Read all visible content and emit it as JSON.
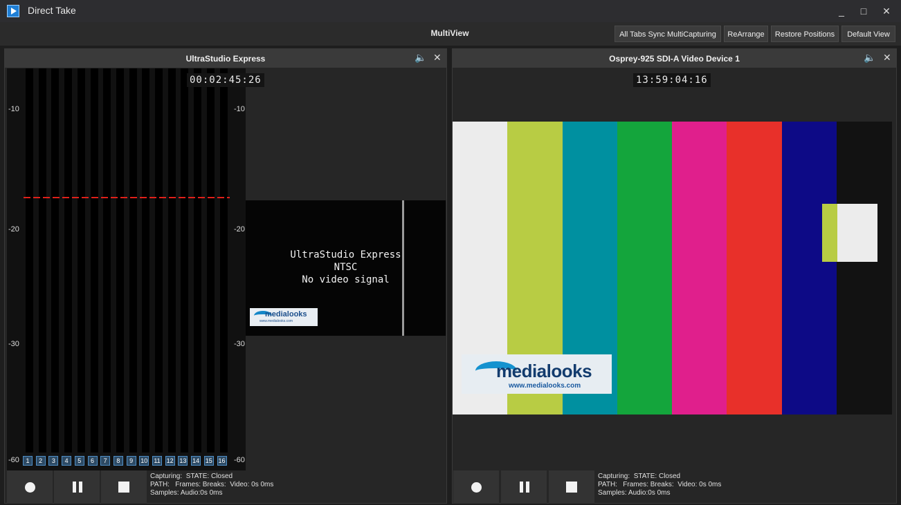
{
  "window": {
    "title": "Direct Take",
    "minimize": "_",
    "maximize": "□",
    "close": "✕"
  },
  "toolbar": {
    "title": "MultiView",
    "buttons": {
      "sync": "All Tabs Sync MultiCapturing",
      "rearrange": "ReArrange",
      "restore": "Restore Positions",
      "default_view": "Default View"
    }
  },
  "panels": [
    {
      "title": "UltraStudio Express",
      "timecode": "00:02:45:26",
      "db_labels": [
        "-10",
        "-20",
        "-30",
        "-60"
      ],
      "channels": [
        "1",
        "2",
        "3",
        "4",
        "5",
        "6",
        "7",
        "8",
        "9",
        "10",
        "11",
        "12",
        "13",
        "14",
        "15",
        "16"
      ],
      "no_signal": {
        "line1": "UltraStudio Express",
        "line2": "NTSC",
        "line3": "No video signal"
      },
      "logo": {
        "name": "medialooks",
        "url": "www.medialooks.com"
      },
      "status": {
        "line1": "Capturing:  STATE: Closed",
        "line2": "PATH:   Frames: Breaks:  Video: 0s 0ms",
        "line3": "Samples: Audio:0s 0ms"
      }
    },
    {
      "title": "Osprey-925 SDI-A Video Device 1",
      "timecode": "13:59:04:16",
      "colorbars": [
        "#ececec",
        "#b8cc44",
        "#0090a0",
        "#14a53c",
        "#e01f8c",
        "#e8302a",
        "#0d0a86",
        "#121212"
      ],
      "logo": {
        "name": "medialooks",
        "url": "www.medialooks.com"
      },
      "status": {
        "line1": "Capturing:  STATE: Closed",
        "line2": "PATH:   Frames: Breaks:  Video: 0s 0ms",
        "line3": "Samples: Audio:0s 0ms"
      }
    }
  ],
  "icons": {
    "app": "app-logo-icon",
    "audio_toggle": "speaker-mute-icon",
    "close": "close-icon",
    "record": "record-icon",
    "pause": "pause-icon",
    "stop": "stop-icon"
  }
}
